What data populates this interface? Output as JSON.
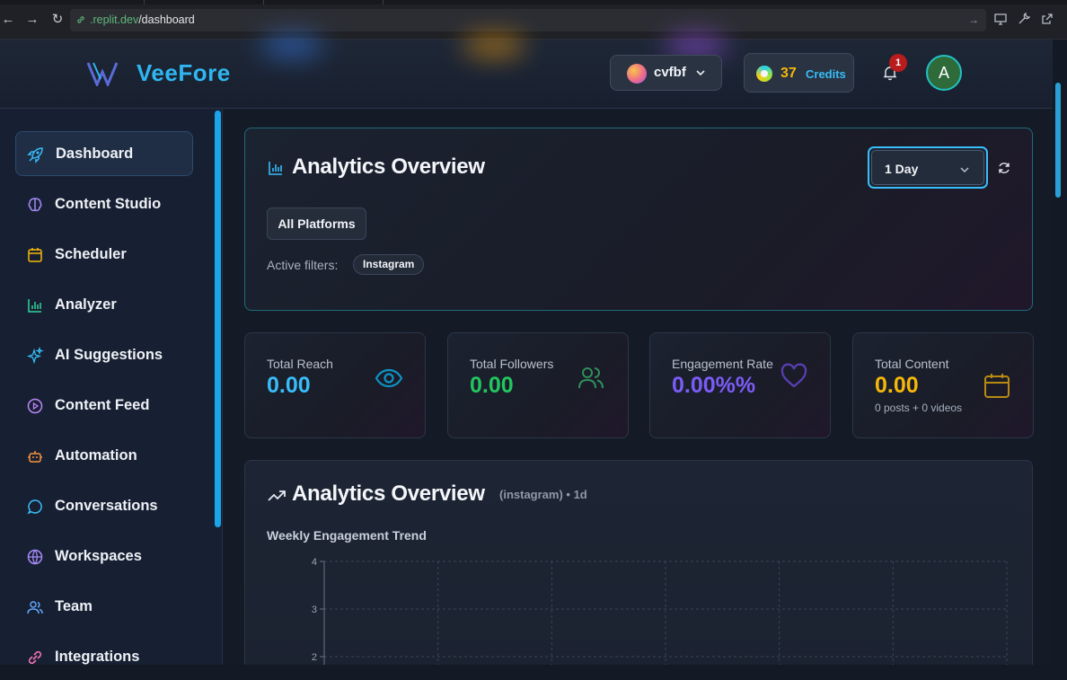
{
  "browser": {
    "url_host": ".replit.dev",
    "url_path": "/dashboard"
  },
  "header": {
    "logo_text": "VeeFore",
    "workspace": "cvfbf",
    "credits_count": "37",
    "credits_label": "Credits",
    "notifications_count": "1",
    "avatar_initial": "A"
  },
  "sidebar": {
    "items": [
      {
        "label": "Dashboard",
        "icon": "rocket-icon",
        "active": true
      },
      {
        "label": "Content Studio",
        "icon": "brain-icon"
      },
      {
        "label": "Scheduler",
        "icon": "calendar-icon"
      },
      {
        "label": "Analyzer",
        "icon": "bar-chart-icon"
      },
      {
        "label": "AI Suggestions",
        "icon": "sparkles-icon"
      },
      {
        "label": "Content Feed",
        "icon": "play-circle-icon"
      },
      {
        "label": "Automation",
        "icon": "bot-icon"
      },
      {
        "label": "Conversations",
        "icon": "chat-bubble-icon"
      },
      {
        "label": "Workspaces",
        "icon": "globe-icon"
      },
      {
        "label": "Team",
        "icon": "users-icon"
      },
      {
        "label": "Integrations",
        "icon": "link-icon"
      }
    ]
  },
  "overview": {
    "title": "Analytics Overview",
    "range": "1 Day",
    "platform_button": "All Platforms",
    "filters_label": "Active filters:",
    "filter_chip": "Instagram"
  },
  "stats": [
    {
      "label": "Total Reach",
      "value": "0.00",
      "color": "#38bdf8",
      "icon": "eye-icon"
    },
    {
      "label": "Total Followers",
      "value": "0.00",
      "color": "#22c55e",
      "icon": "users-icon"
    },
    {
      "label": "Engagement Rate",
      "value": "0.00%%",
      "color": "#7c5cf6",
      "icon": "heart-icon"
    },
    {
      "label": "Total Content",
      "value": "0.00",
      "sub": "0 posts + 0 videos",
      "color": "#f5b70a",
      "icon": "calendar-icon"
    }
  ],
  "chart_section": {
    "title": "Analytics Overview",
    "meta": "(instagram) • 1d",
    "subtitle": "Weekly Engagement Trend"
  },
  "chart_data": {
    "type": "line",
    "title": "Weekly Engagement Trend",
    "x": [],
    "series": [],
    "yticks": [
      4,
      3,
      2
    ],
    "ylim": [
      0,
      4
    ],
    "grid": true
  }
}
